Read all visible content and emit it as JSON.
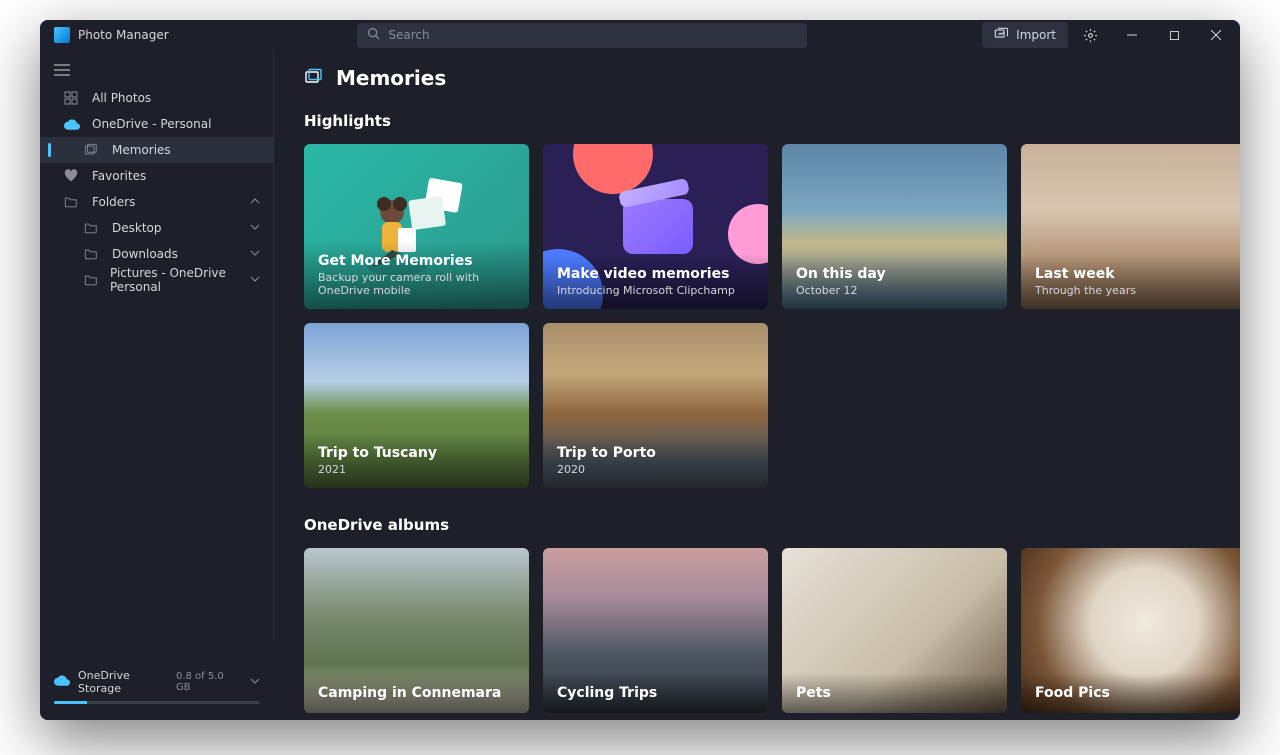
{
  "app": {
    "title": "Photo Manager"
  },
  "search": {
    "placeholder": "Search"
  },
  "toolbar": {
    "import_label": "Import"
  },
  "sidebar": {
    "items": [
      {
        "icon": "grid",
        "label": "All Photos"
      },
      {
        "icon": "cloud",
        "label": "OneDrive - Personal"
      },
      {
        "icon": "memories",
        "label": "Memories",
        "active": true,
        "nested": true
      },
      {
        "icon": "heart",
        "label": "Favorites"
      },
      {
        "icon": "folder",
        "label": "Folders",
        "chev": "up"
      },
      {
        "icon": "folder",
        "label": "Desktop",
        "nested": true,
        "chev": "down"
      },
      {
        "icon": "folder",
        "label": "Downloads",
        "nested": true,
        "chev": "down"
      },
      {
        "icon": "folder",
        "label": "Pictures - OneDrive Personal",
        "nested": true,
        "chev": "down"
      }
    ],
    "storage": {
      "label": "OneDrive Storage",
      "value": "0.8 of 5.0 GB",
      "percent": 16
    }
  },
  "page": {
    "title": "Memories"
  },
  "sections": {
    "highlights": {
      "heading": "Highlights",
      "cards": [
        {
          "title": "Get More Memories",
          "subtitle": "Backup your camera roll with OneDrive mobile",
          "kind": "promo-1"
        },
        {
          "title": "Make video memories",
          "subtitle": "Introducing Microsoft Clipchamp",
          "kind": "promo-2"
        },
        {
          "title": "On this day",
          "subtitle": "October 12",
          "kind": "ph-coast"
        },
        {
          "title": "Last week",
          "subtitle": "Through the years",
          "kind": "ph-desert"
        },
        {
          "title": "Trip to Tuscany",
          "subtitle": "2021",
          "kind": "ph-tuscany"
        },
        {
          "title": "Trip to Porto",
          "subtitle": "2020",
          "kind": "ph-porto"
        }
      ]
    },
    "albums": {
      "heading": "OneDrive albums",
      "cards": [
        {
          "title": "Camping in Connemara",
          "kind": "ph-connemara"
        },
        {
          "title": "Cycling Trips",
          "kind": "ph-cycling"
        },
        {
          "title": "Pets",
          "kind": "ph-pets"
        },
        {
          "title": "Food Pics",
          "kind": "ph-food"
        }
      ]
    }
  }
}
